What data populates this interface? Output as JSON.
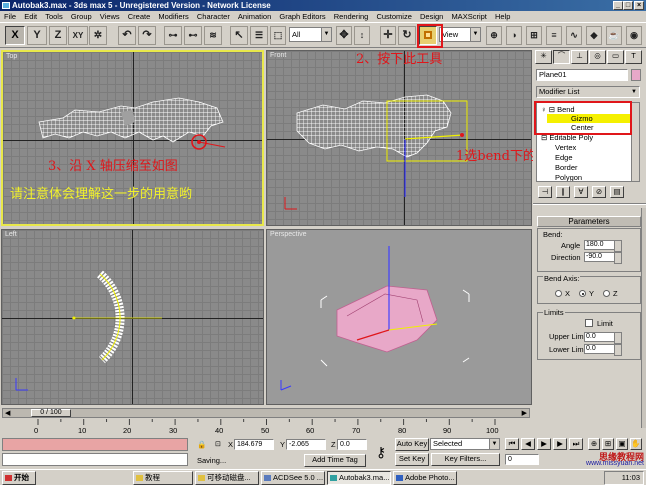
{
  "window": {
    "title": "Autobak3.max - 3ds max 5 - Unregistered Version - Network License"
  },
  "menu": [
    "File",
    "Edit",
    "Tools",
    "Group",
    "Views",
    "Create",
    "Modifiers",
    "Character",
    "Animation",
    "Graph Editors",
    "Rendering",
    "Customize",
    "Design",
    "MAXScript",
    "Help"
  ],
  "toolbar": {
    "axis_x": "X",
    "axis_y": "Y",
    "axis_z": "Z",
    "axis_xy": "XY",
    "selection_filter": "All",
    "reference_coord": "View"
  },
  "viewports": {
    "top": {
      "label": "Top"
    },
    "front": {
      "label": "Front"
    },
    "left": {
      "label": "Left"
    },
    "perspective": {
      "label": "Perspective"
    }
  },
  "annotations": {
    "step2": "2、按下此工具",
    "step3": "3、沿 X 轴压缩至如图",
    "note": "请注意体会理解这一步的用意哟",
    "step1": "1选bend下的gizmo"
  },
  "command_panel": {
    "object_name": "Plane01",
    "modifier_list": "Modifier List",
    "stack": {
      "bend": "Bend",
      "gizmo": "Gizmo",
      "center": "Center",
      "editable_poly": "Editable Poly",
      "vertex": "Vertex",
      "edge": "Edge",
      "border": "Border",
      "polygon": "Polygon"
    },
    "parameters_title": "Parameters",
    "bend_label": "Bend:",
    "angle_label": "Angle",
    "angle_value": "180.0",
    "direction_label": "Direction",
    "direction_value": "-90.0",
    "bend_axis_label": "Bend Axis:",
    "axis_x": "X",
    "axis_y": "Y",
    "axis_z": "Z",
    "selected_axis": "Y",
    "limits_label": "Limits",
    "limit_checkbox": "Limit",
    "upper_limit_label": "Upper Limit",
    "upper_limit_value": "0.0",
    "lower_limit_label": "Lower Limit",
    "lower_limit_value": "0.0"
  },
  "timeline": {
    "frame_counter": "0 / 100",
    "ticks": [
      "0",
      "10",
      "20",
      "30",
      "40",
      "50",
      "60",
      "70",
      "80",
      "90",
      "100"
    ]
  },
  "status": {
    "status_text": "Saving...",
    "x_label": "X",
    "x_value": "184.679",
    "y_label": "Y",
    "y_value": "-2.065",
    "z_label": "Z",
    "z_value": "0.0",
    "auto_key": "Auto Key",
    "selected": "Selected",
    "set_key": "Set Key",
    "key_filters": "Key Filters...",
    "add_time_tag": "Add Time Tag",
    "frame": "0"
  },
  "taskbar": {
    "start": "开始",
    "tasks": [
      "教程",
      "可移动磁盘...",
      "ACDSee 5.0 ...",
      "Autobak3.ma...",
      "Adobe Photo..."
    ],
    "clock": "11:03"
  },
  "watermark": {
    "line1": "思缘教程网",
    "line2": "www.missyuan.net"
  },
  "colors": {
    "annotation_red": "#e0161a",
    "annotation_yellow": "#f2f22a",
    "viewport_active": "#e8e84a",
    "gizmo_highlight": "#f5f000"
  }
}
